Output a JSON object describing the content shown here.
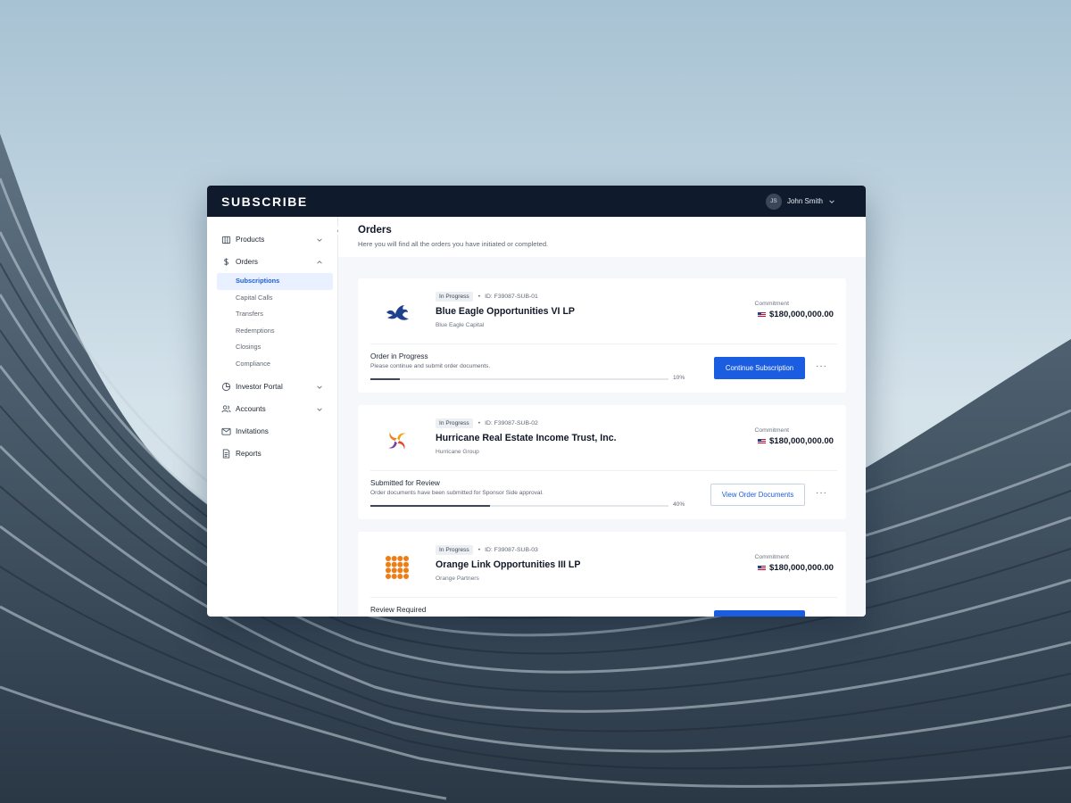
{
  "app": {
    "brand": "SUBSCRIBE"
  },
  "user": {
    "initials": "JS",
    "name": "John Smith"
  },
  "sidebar": {
    "items": [
      {
        "label": "Products",
        "icon": "building-icon",
        "expanded": false
      },
      {
        "label": "Orders",
        "icon": "dollar-icon",
        "expanded": true,
        "children": [
          "Subscriptions",
          "Capital Calls",
          "Transfers",
          "Redemptions",
          "Closings",
          "Compliance"
        ],
        "active_child": "Subscriptions"
      },
      {
        "label": "Investor Portal",
        "icon": "pie-chart-icon",
        "expanded": false
      },
      {
        "label": "Accounts",
        "icon": "users-icon",
        "expanded": false
      },
      {
        "label": "Invitations",
        "icon": "mail-icon"
      },
      {
        "label": "Reports",
        "icon": "document-icon"
      }
    ]
  },
  "page": {
    "title": "Orders",
    "subtitle": "Here you will find all the orders you have initiated or completed."
  },
  "orders": [
    {
      "status_badge": "In Progress",
      "id": "ID: F39087-SUB-01",
      "title": "Blue Eagle Opportunities VI LP",
      "org": "Blue Eagle Capital",
      "logo": "eagle-logo",
      "commitment_label": "Commitment",
      "commitment": "$180,000,000.00",
      "stage_title": "Order in Progress",
      "stage_desc": "Please continue and submit order documents.",
      "progress": 0.1,
      "progress_label": "10%",
      "action": "Continue Subscription",
      "action_style": "primary"
    },
    {
      "status_badge": "In Progress",
      "id": "ID: F39087-SUB-02",
      "title": "Hurricane Real Estate Income Trust, Inc.",
      "org": "Hurricane Group",
      "logo": "hurricane-logo",
      "commitment_label": "Commitment",
      "commitment": "$180,000,000.00",
      "stage_title": "Submitted for Review",
      "stage_desc": "Order documents have been submitted for Sponsor Side approval.",
      "progress": 0.4,
      "progress_label": "40%",
      "action": "View Order Documents",
      "action_style": "secondary"
    },
    {
      "status_badge": "In Progress",
      "id": "ID: F39087-SUB-03",
      "title": "Orange Link Opportunities III LP",
      "org": "Orange Partners",
      "logo": "orange-dots-logo",
      "commitment_label": "Commitment",
      "commitment": "$180,000,000.00",
      "stage_title": "Review Required",
      "stage_desc": "",
      "progress": null,
      "progress_label": "",
      "action": "",
      "action_style": "primary"
    }
  ],
  "colors": {
    "topbar": "#0f1a2c",
    "accent": "#1b5de0",
    "active_bg": "#e9f0ff"
  }
}
